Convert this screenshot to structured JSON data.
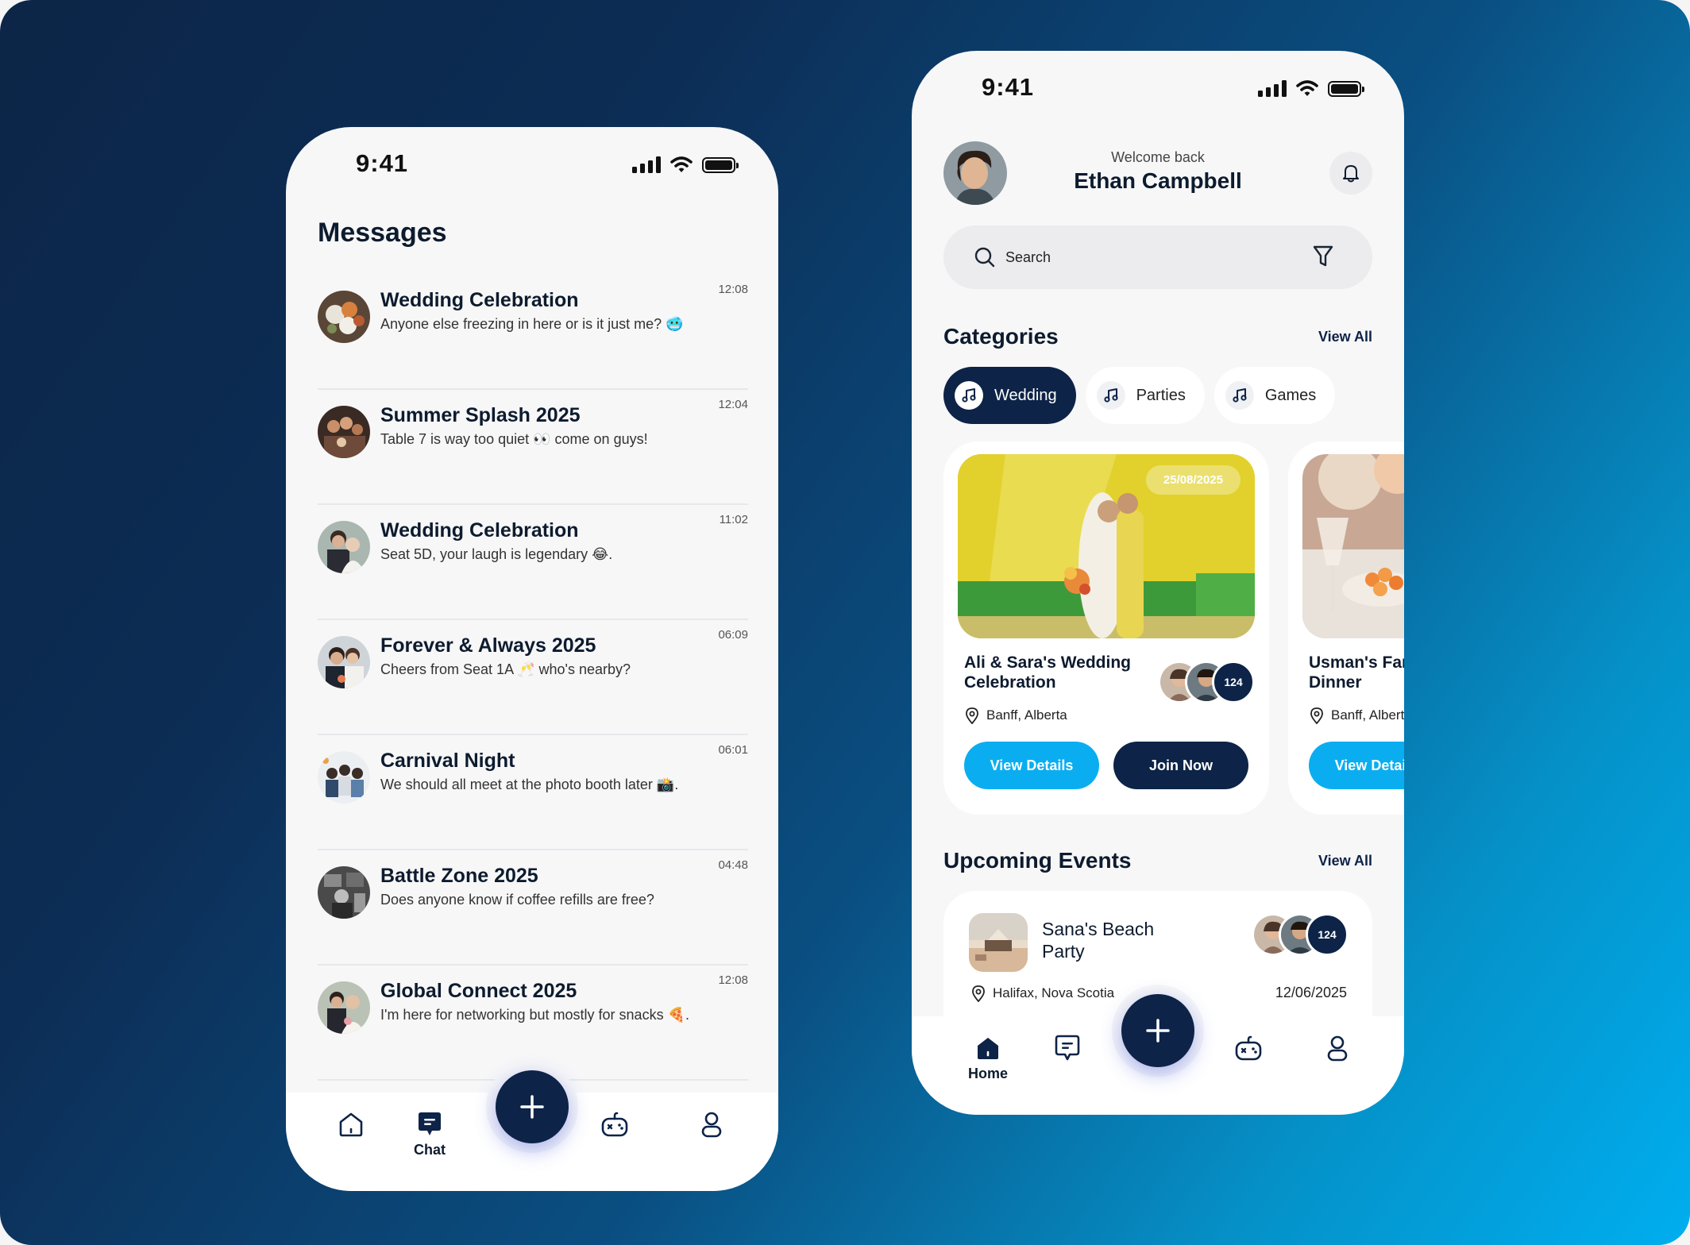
{
  "chat_screen": {
    "status": {
      "time": "9:41"
    },
    "title": "Messages",
    "messages": [
      {
        "title": "Wedding Celebration",
        "preview": "Anyone else freezing in here or is it just me? 🥶",
        "time": "12:08"
      },
      {
        "title": "Summer Splash 2025",
        "preview": "Table 7 is way too quiet 👀 come on guys!",
        "time": "12:04"
      },
      {
        "title": "Wedding Celebration",
        "preview": "Seat 5D, your laugh is legendary 😂.",
        "time": "11:02"
      },
      {
        "title": "Forever & Always 2025",
        "preview": "Cheers from Seat 1A 🥂 who's nearby?",
        "time": "06:09"
      },
      {
        "title": "Carnival Night",
        "preview": "We should all meet at the photo booth later 📸.",
        "time": "06:01"
      },
      {
        "title": "Battle Zone 2025",
        "preview": "Does anyone know if coffee refills are free?",
        "time": "04:48"
      },
      {
        "title": "Global Connect 2025",
        "preview": "I'm here for networking but mostly for snacks 🍕.",
        "time": "12:08"
      }
    ],
    "nav": {
      "active_label": "Chat"
    }
  },
  "home_screen": {
    "status": {
      "time": "9:41"
    },
    "welcome": "Welcome back",
    "user_name": "Ethan Campbell",
    "search": {
      "placeholder": "Search"
    },
    "categories": {
      "title": "Categories",
      "view_all": "View All",
      "items": [
        {
          "label": "Wedding",
          "active": true
        },
        {
          "label": "Parties",
          "active": false
        },
        {
          "label": "Games",
          "active": false
        }
      ]
    },
    "featured_events": [
      {
        "date": "25/08/2025",
        "title": "Ali & Sara's Wedding Celebration",
        "location": "Banff, Alberta",
        "attendees": "124",
        "view_label": "View Details",
        "join_label": "Join Now"
      },
      {
        "title": "Usman's Family Dinner",
        "location": "Banff, Alberta",
        "view_label": "View Details"
      }
    ],
    "upcoming": {
      "title": "Upcoming Events",
      "view_all": "View All",
      "event": {
        "title": "Sana's Beach Party",
        "location": "Halifax, Nova Scotia",
        "date": "12/06/2025",
        "attendees": "124"
      }
    },
    "nav": {
      "active_label": "Home"
    }
  },
  "colors": {
    "navy": "#0d2347",
    "accent_blue": "#0aaef0",
    "background_gradient_start": "#0c2547",
    "background_gradient_end": "#00aeef"
  },
  "icons": [
    "signal-icon",
    "wifi-icon",
    "battery-icon",
    "home-icon",
    "chat-icon",
    "plus-icon",
    "gamepad-icon",
    "profile-icon",
    "bell-icon",
    "search-icon",
    "filter-icon",
    "music-note-icon",
    "location-pin-icon"
  ]
}
